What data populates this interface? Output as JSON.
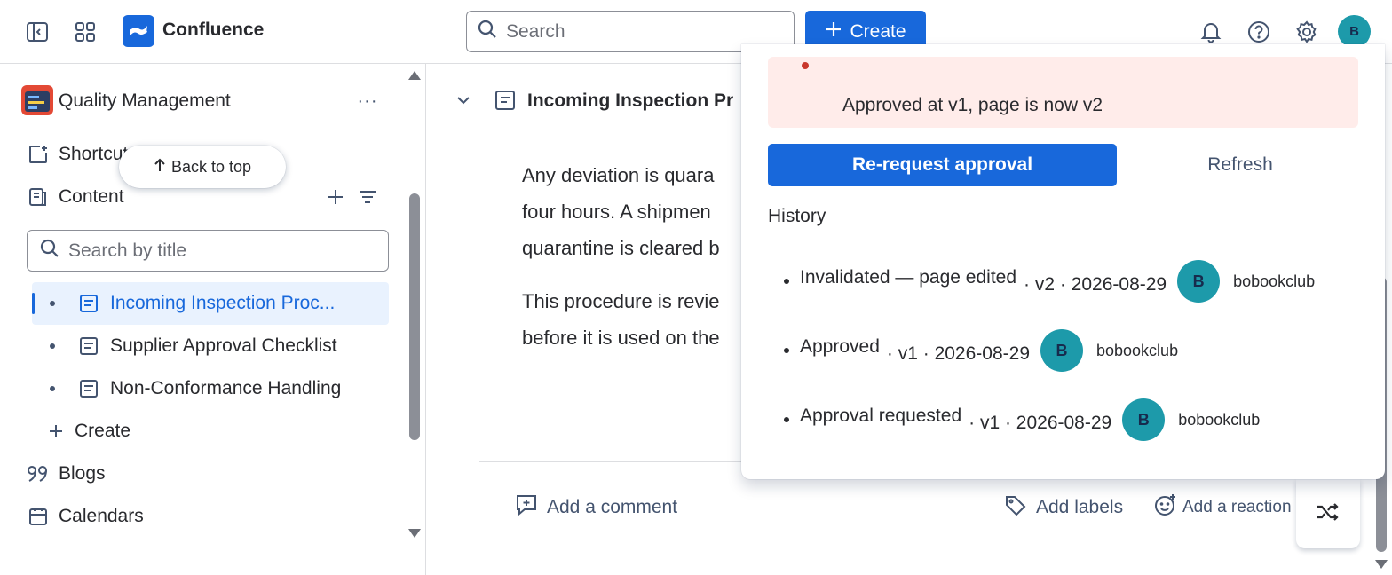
{
  "topbar": {
    "app_name": "Confluence",
    "search_placeholder": "Search",
    "create_label": "Create",
    "avatar_initial": "B"
  },
  "sidebar": {
    "space_name": "Quality Management",
    "more_label": "···",
    "shortcuts_label": "Shortcuts",
    "back_to_top": "Back to top",
    "content_label": "Content",
    "search_placeholder": "Search by title",
    "tree": [
      {
        "label": "Incoming Inspection Proc...",
        "selected": true
      },
      {
        "label": "Supplier Approval Checklist",
        "selected": false
      },
      {
        "label": "Non-Conformance Handling",
        "selected": false
      }
    ],
    "create_label": "Create",
    "blogs_label": "Blogs",
    "calendars_label": "Calendars"
  },
  "main": {
    "page_title": "Incoming Inspection Pr",
    "paragraphs": [
      [
        "Any deviation is quara",
        "four hours. A shipmen",
        "quarantine is cleared b"
      ],
      [
        "This procedure is revie",
        "before it is used on the"
      ]
    ],
    "add_comment": "Add a comment",
    "add_labels": "Add labels",
    "add_reaction": "Add a reaction"
  },
  "approval_popup": {
    "alert_text": "Approved at v1, page is now v2",
    "rerequest_label": "Re-request approval",
    "refresh_label": "Refresh",
    "history_heading": "History",
    "history": [
      {
        "action": "Invalidated — page edited",
        "meta": "· v2 · 2026-08-29",
        "avatar": "B",
        "user": "bobookclub"
      },
      {
        "action": "Approved",
        "meta": "· v1 · 2026-08-29",
        "avatar": "B",
        "user": "bobookclub"
      },
      {
        "action": "Approval requested",
        "meta": "· v1 · 2026-08-29",
        "avatar": "B",
        "user": "bobookclub"
      }
    ]
  },
  "colors": {
    "brand": "#1868db",
    "avatar": "#1d9aaa",
    "alert_bg": "#ffecea",
    "selected_bg": "#e9f2fe"
  },
  "icons": [
    "sidebar-toggle-icon",
    "app-switcher-icon",
    "confluence-logo-icon",
    "search-icon",
    "plus-icon",
    "bell-icon",
    "help-icon",
    "gear-icon",
    "shortcut-icon",
    "content-icon",
    "filter-icon",
    "page-icon",
    "quote-icon",
    "calendar-icon",
    "chevron-down-icon",
    "comment-icon",
    "tag-icon",
    "emoji-icon",
    "shuffle-icon",
    "arrow-up-icon"
  ]
}
